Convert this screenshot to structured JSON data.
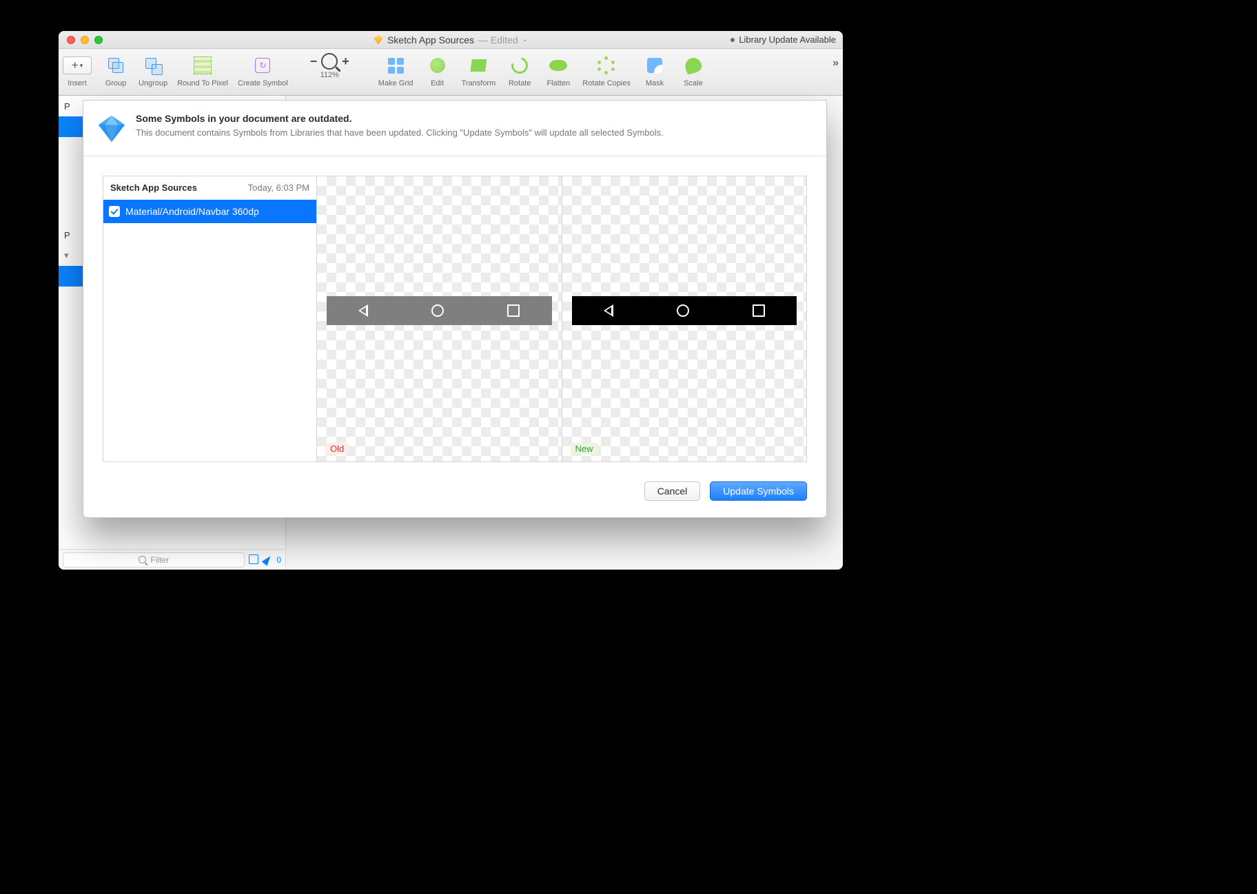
{
  "window": {
    "title_document": "Sketch App Sources",
    "title_state": "— Edited",
    "library_badge": "Library Update Available"
  },
  "toolbar": {
    "insert": "Insert",
    "group": "Group",
    "ungroup": "Ungroup",
    "roundpx": "Round To Pixel",
    "createsymbol": "Create Symbol",
    "zoom": "112%",
    "makegrid": "Make Grid",
    "edit": "Edit",
    "transform": "Transform",
    "rotate": "Rotate",
    "flatten": "Flatten",
    "rotcopies": "Rotate Copies",
    "mask": "Mask",
    "scale": "Scale"
  },
  "sidebar": {
    "row0_prefix": "P",
    "row1_prefix": "P"
  },
  "dialog": {
    "title": "Some Symbols in your document are outdated.",
    "desc": "This document contains Symbols from Libraries that have been updated. Clicking \"Update Symbols\" will update all selected Symbols.",
    "library_name": "Sketch App Sources",
    "timestamp": "Today, 6:03 PM",
    "items": [
      {
        "checked": true,
        "name": "Material/Android/Navbar 360dp"
      }
    ],
    "old_label": "Old",
    "new_label": "New",
    "cancel": "Cancel",
    "confirm": "Update Symbols"
  },
  "filter": {
    "placeholder": "Filter",
    "count": "0"
  }
}
